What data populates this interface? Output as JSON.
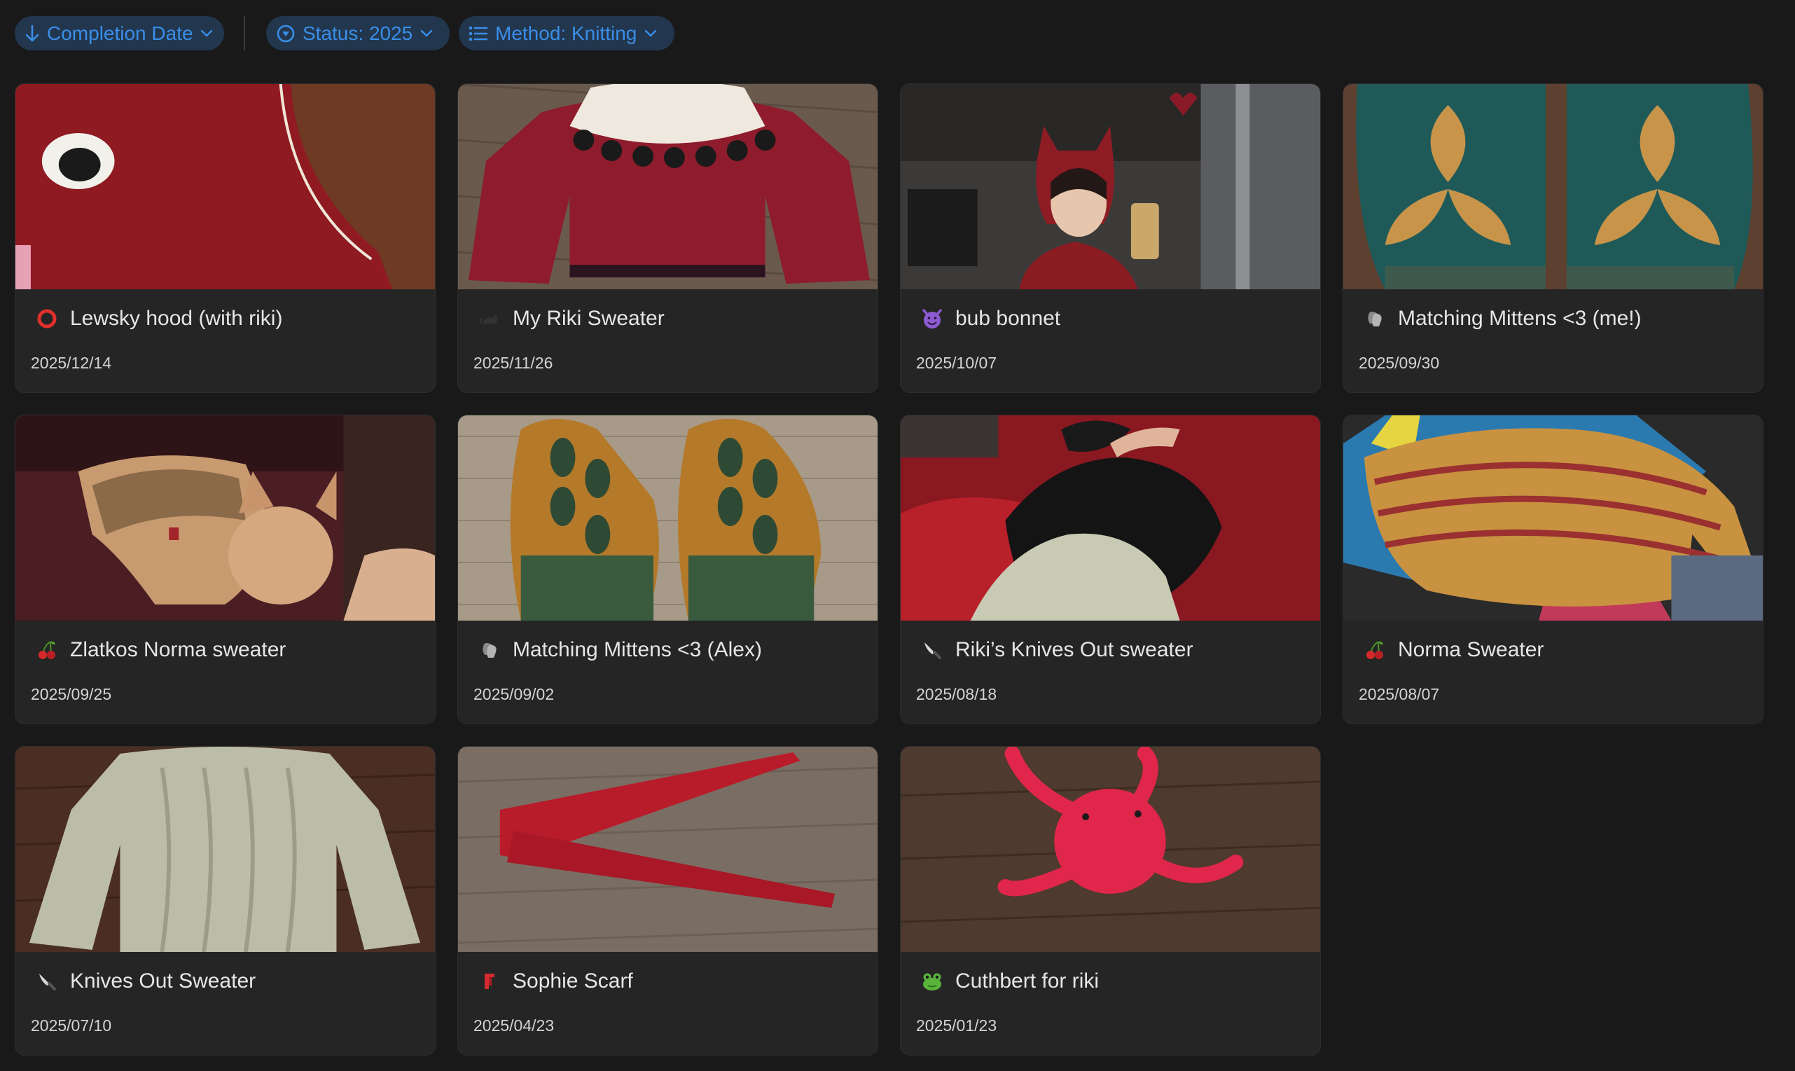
{
  "toolbar": {
    "sort_label": "Completion Date",
    "status_label": "Status: 2025",
    "method_label": "Method: Knitting"
  },
  "colors": {
    "background": "#191919",
    "card": "#252525",
    "chip_bg": "#22364d",
    "chip_text": "#3a8ee8"
  },
  "cards": [
    {
      "title": "Lewsky hood (with riki)",
      "date": "2025/12/14",
      "icon": "red-circle-icon"
    },
    {
      "title": "My Riki Sweater",
      "date": "2025/11/26",
      "icon": "black-cat-icon"
    },
    {
      "title": "bub bonnet",
      "date": "2025/10/07",
      "icon": "smiling-devil-icon"
    },
    {
      "title": "Matching Mittens <3 (me!)",
      "date": "2025/09/30",
      "icon": "gloves-icon"
    },
    {
      "title": "Zlatkos Norma sweater",
      "date": "2025/09/25",
      "icon": "cherries-icon"
    },
    {
      "title": "Matching Mittens <3 (Alex)",
      "date": "2025/09/02",
      "icon": "gloves-icon"
    },
    {
      "title": "Riki’s Knives Out sweater",
      "date": "2025/08/18",
      "icon": "knife-icon"
    },
    {
      "title": "Norma Sweater",
      "date": "2025/08/07",
      "icon": "cherries-icon"
    },
    {
      "title": "Knives Out Sweater",
      "date": "2025/07/10",
      "icon": "knife-icon"
    },
    {
      "title": "Sophie Scarf",
      "date": "2025/04/23",
      "icon": "scarf-icon"
    },
    {
      "title": "Cuthbert for riki",
      "date": "2025/01/23",
      "icon": "frog-icon"
    }
  ]
}
